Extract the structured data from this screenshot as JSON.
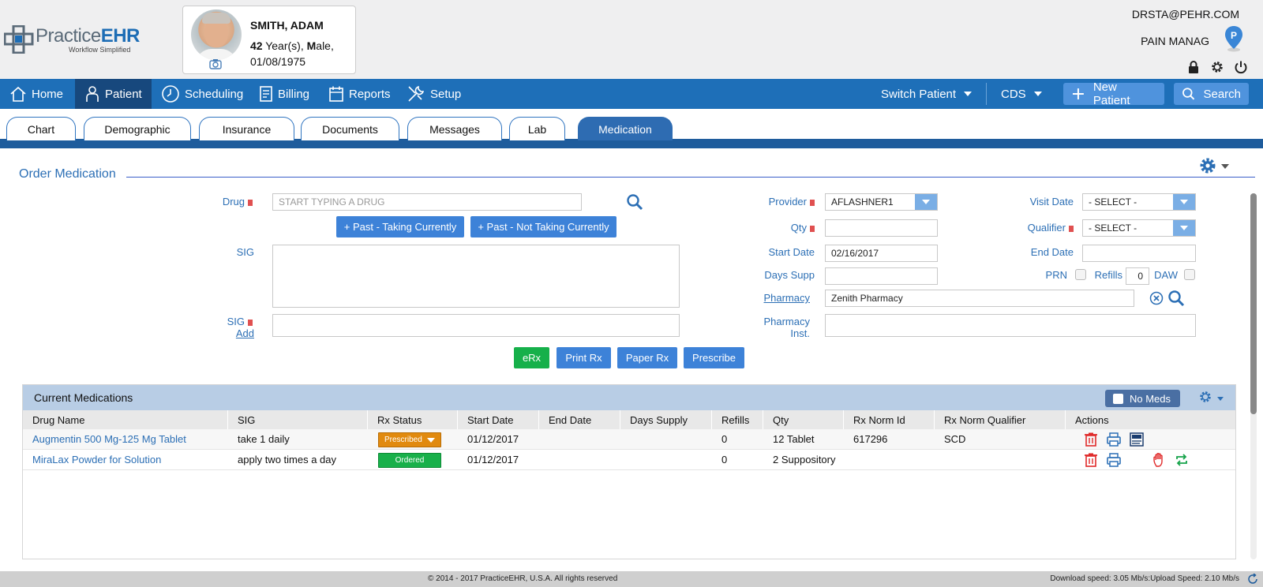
{
  "app": {
    "logo_name_a": "Practice",
    "logo_name_b": "EHR",
    "logo_tagline": "Workflow Simplified"
  },
  "patient": {
    "name": "SMITH, ADAM",
    "age": "42",
    "age_unit": " Year(s), ",
    "gender_initial": "M",
    "gender_rest": "ale,",
    "dob": "01/08/1975"
  },
  "user": {
    "email": "DRSTA@PEHR.COM",
    "practice": "PAIN MANAG",
    "pin_letter": "P"
  },
  "nav": {
    "items": [
      {
        "label": "Home",
        "icon": "home-icon"
      },
      {
        "label": "Patient",
        "icon": "person-icon"
      },
      {
        "label": "Scheduling",
        "icon": "clock-icon"
      },
      {
        "label": "Billing",
        "icon": "invoice-icon"
      },
      {
        "label": "Reports",
        "icon": "calendar-icon"
      },
      {
        "label": "Setup",
        "icon": "tools-icon"
      }
    ],
    "switch_patient": "Switch Patient",
    "cds": "CDS",
    "new_patient": "New Patient",
    "search": "Search"
  },
  "tabs": [
    "Chart",
    "Demographic",
    "Insurance",
    "Documents",
    "Messages",
    "Lab",
    "Medication"
  ],
  "active_tab": "Medication",
  "form": {
    "title": "Order Medication",
    "drug_label": "Drug",
    "drug_placeholder": "START TYPING A DRUG",
    "past_taking": "+ Past - Taking Currently",
    "past_not_taking": "+ Past - Not Taking Currently",
    "sig_label": "SIG",
    "sig2_label": "SIG",
    "sig_add": "Add",
    "provider_label": "Provider",
    "provider_value": "AFLASHNER1",
    "visit_date_label": "Visit Date",
    "visit_date_value": "- SELECT -",
    "qty_label": "Qty",
    "qty_value": "",
    "qualifier_label": "Qualifier",
    "qualifier_value": "- SELECT -",
    "start_date_label": "Start Date",
    "start_date_value": "02/16/2017",
    "end_date_label": "End Date",
    "end_date_value": "",
    "days_supp_label": "Days Supp",
    "days_supp_value": "",
    "prn_label": "PRN",
    "refills_label": "Refills",
    "refills_value": "0",
    "daw_label": "DAW",
    "pharmacy_label": "Pharmacy",
    "pharmacy_value": "Zenith Pharmacy",
    "pharmacy_inst_label_1": "Pharmacy",
    "pharmacy_inst_label_2": "Inst.",
    "erx": "eRx",
    "print_rx": "Print Rx",
    "paper_rx": "Paper Rx",
    "prescribe": "Prescribe"
  },
  "meds": {
    "title": "Current Medications",
    "no_meds": "No Meds",
    "columns": [
      "Drug Name",
      "SIG",
      "Rx Status",
      "Start Date",
      "End Date",
      "Days Supply",
      "Refills",
      "Qty",
      "Rx Norm Id",
      "Rx Norm Qualifier",
      "Actions"
    ],
    "rows": [
      {
        "drug": "Augmentin 500 Mg-125 Mg Tablet",
        "sig": "take 1 daily",
        "status": "Prescribed",
        "start": "01/12/2017",
        "end": "",
        "days": "",
        "refills": "0",
        "qty": "12 Tablet",
        "rxnorm": "617296",
        "qualifier": "SCD"
      },
      {
        "drug": "MiraLax Powder for Solution",
        "sig": "apply two times a day",
        "status": "Ordered",
        "start": "01/12/2017",
        "end": "",
        "days": "",
        "refills": "0",
        "qty": "2 Suppository",
        "rxnorm": "",
        "qualifier": ""
      }
    ]
  },
  "footer": {
    "copyright": "© 2014 - 2017 PracticeEHR, U.S.A. All rights reserved",
    "speed": "Download speed: 3.05 Mb/s:Upload Speed: 2.10 Mb/s"
  },
  "colors": {
    "nav_bg": "#1e6fb8",
    "nav_active": "#17487d",
    "accent": "#2c6fb5",
    "prescribed": "#e18a0f",
    "ordered": "#18b04a"
  }
}
